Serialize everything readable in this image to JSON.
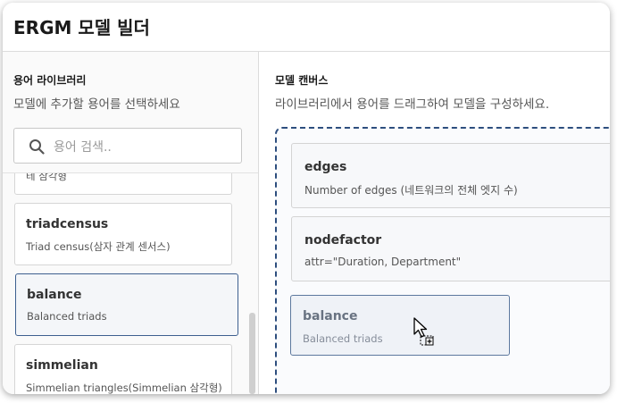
{
  "header": {
    "title": "ERGM 모델 빌더"
  },
  "library": {
    "title": "용어 라이브러리",
    "subtitle": "모델에 추가할 용어를 선택하세요",
    "search": {
      "placeholder": "용어 검색.."
    },
    "items": [
      {
        "desc": "테 삼각형"
      },
      {
        "name": "triadcensus",
        "desc": "Triad census(삼자 관계 센서스)"
      },
      {
        "name": "balance",
        "desc": "Balanced triads",
        "selected": true
      },
      {
        "name": "simmelian",
        "desc": "Simmelian triangles(Simmelian 삼각형)"
      }
    ]
  },
  "canvas": {
    "title": "모델 캔버스",
    "subtitle": "라이브러리에서 용어를 드래그하여 모델을 구성하세요.",
    "terms": [
      {
        "name": "edges",
        "desc": "Number of edges (네트워크의 전체 엣지 수)"
      },
      {
        "name": "nodefactor",
        "desc": "attr=\"Duration, Department\""
      }
    ],
    "dragging": {
      "name": "balance",
      "desc": "Balanced triads"
    }
  },
  "colors": {
    "accent": "#2d4e7e",
    "selected_border": "#3d5f8f"
  }
}
